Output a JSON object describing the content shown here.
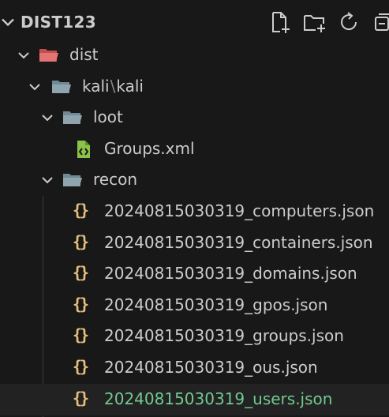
{
  "explorer": {
    "root_label": "DIST123",
    "toolbar": {
      "new_file": "new-file-icon",
      "new_folder": "new-folder-icon",
      "refresh": "refresh-icon",
      "collapse": "collapse-all-icon"
    }
  },
  "tree": {
    "dist": "dist",
    "kali_a": "kali",
    "kali_sep": "\\",
    "kali_b": "kali",
    "loot": "loot",
    "groups_xml": "Groups.xml",
    "recon": "recon",
    "files": [
      "20240815030319_computers.json",
      "20240815030319_containers.json",
      "20240815030319_domains.json",
      "20240815030319_gpos.json",
      "20240815030319_groups.json",
      "20240815030319_ous.json",
      "20240815030319_users.json"
    ]
  },
  "colors": {
    "background": "#181818",
    "text": "#cccccc",
    "folder": "#90a4ae",
    "dist_folder": "#e57373",
    "json_icon": "#e5c07b",
    "xml_icon": "#8bc34a",
    "modified_text": "#73c991"
  }
}
